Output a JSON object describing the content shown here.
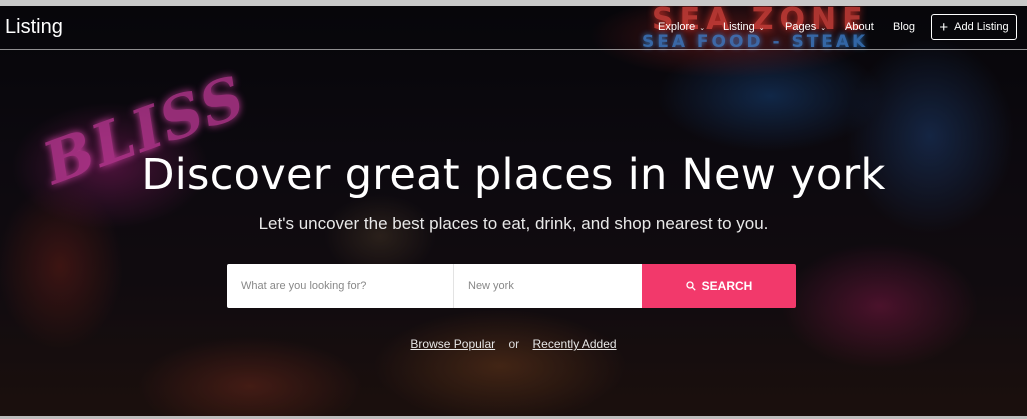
{
  "navbar": {
    "brand": "Listing",
    "items": [
      {
        "label": "Explore",
        "has_dropdown": true
      },
      {
        "label": "Listing",
        "has_dropdown": true
      },
      {
        "label": "Pages",
        "has_dropdown": true
      },
      {
        "label": "About",
        "has_dropdown": false
      },
      {
        "label": "Blog",
        "has_dropdown": false
      }
    ],
    "add_button_label": "Add Listing"
  },
  "hero": {
    "headline": "Discover great places in New york",
    "subheadline": "Let's uncover the best places to eat, drink, and shop nearest to you.",
    "background_signs": {
      "sign_1": "BLISS",
      "sign_2": "SEA ZONE",
      "sign_3": "SEA FOOD - STEAK"
    }
  },
  "search": {
    "what_placeholder": "What are you looking for?",
    "where_placeholder": "New york",
    "button_label": "SEARCH",
    "button_color": "#f2396b"
  },
  "quick_links": {
    "browse_popular": "Browse Popular",
    "separator": "or",
    "recently_added": "Recently Added"
  },
  "icons": [
    "chevron-down-icon",
    "plus-icon",
    "search-icon"
  ]
}
